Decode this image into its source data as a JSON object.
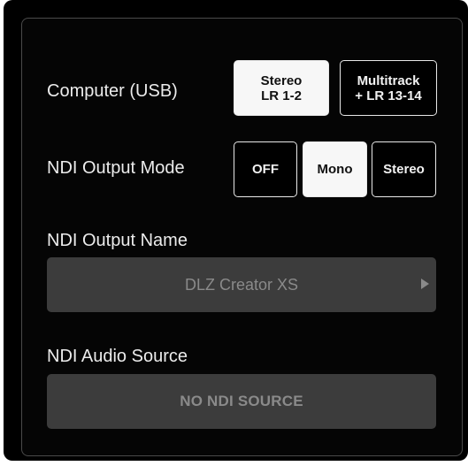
{
  "computer_usb": {
    "label": "Computer (USB)",
    "options": [
      {
        "line1": "Stereo",
        "line2": "LR 1-2",
        "selected": true
      },
      {
        "line1": "Multitrack",
        "line2": "+ LR 13-14",
        "selected": false
      }
    ]
  },
  "ndi_output_mode": {
    "label": "NDI Output Mode",
    "options": [
      {
        "label": "OFF",
        "selected": false
      },
      {
        "label": "Mono",
        "selected": true
      },
      {
        "label": "Stereo",
        "selected": false
      }
    ]
  },
  "ndi_output_name": {
    "label": "NDI Output Name",
    "value": "DLZ Creator XS",
    "icon": "play-arrow-icon"
  },
  "ndi_audio_source": {
    "label": "NDI Audio Source",
    "value": "NO NDI SOURCE"
  },
  "colors": {
    "background": "#000000",
    "selected_button": "#f7f7f7",
    "field_background": "#3c3c3c",
    "field_text": "#8a8a8a"
  }
}
